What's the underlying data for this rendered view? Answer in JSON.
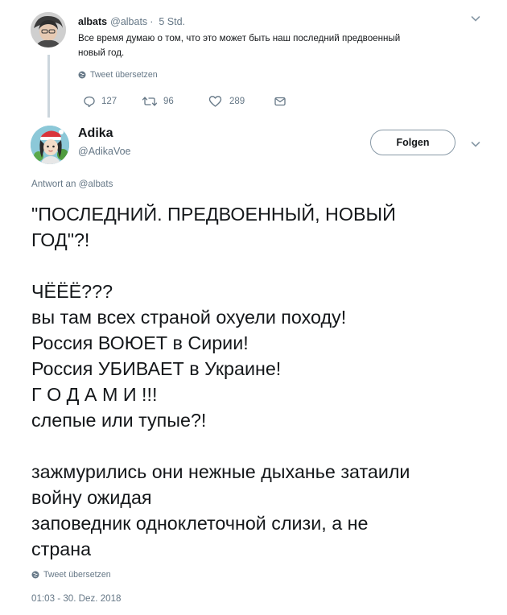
{
  "first_tweet": {
    "name": "albats",
    "handle": "@albats",
    "separator": "·",
    "time": "5 Std.",
    "lines": [
      "Все время думаю о том, что это может быть наш последний предвоенный",
      "новый год."
    ],
    "translate_label": "Tweet übersetzen",
    "reply_count": "127",
    "retweet_count": "96",
    "like_count": "289"
  },
  "reply_tweet": {
    "name": "Adika",
    "handle": "@AdikaVoe",
    "follow_label": "Folgen",
    "reply_to_prefix": "Antwort an",
    "reply_to_handle": "@albats",
    "paragraphs": [
      [
        "\"ПОСЛЕДНИЙ. ПРЕДВОЕННЫЙ, НОВЫЙ",
        "ГОД\"?!"
      ],
      [
        "ЧЁЁЁ???",
        "вы там всех страной охуели походу!",
        "Россия ВОЮЕТ в Сирии!",
        "Россия УБИВАЕТ в Украине!",
        "Г О Д А М И !!!",
        "слепые или тупые?!"
      ],
      [
        "зажмурились они нежные дыханье затаили",
        "войну ожидая",
        "заповедник одноклеточной слизи, а не",
        "страна"
      ]
    ],
    "translate_label": "Tweet übersetzen",
    "timestamp": "01:03 - 30. Dez. 2018"
  },
  "colors": {
    "text": "#14171a",
    "secondary": "#657786",
    "border": "#8899a6",
    "thread_line": "#ccd6dd"
  },
  "icons": [
    "reply-icon",
    "retweet-icon",
    "like-icon",
    "dm-icon",
    "globe-icon",
    "chevron-down-icon"
  ]
}
